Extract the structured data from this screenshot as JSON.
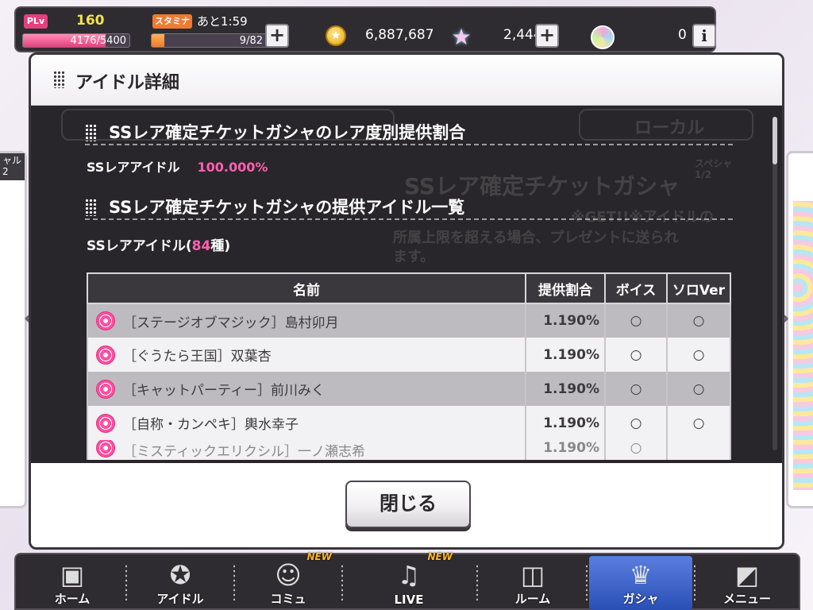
{
  "status": {
    "pl_label": "PLv",
    "pl_level": "160",
    "exp_text": "4176/5400",
    "exp_fraction": 0.773,
    "stamina_label": "スタミナ",
    "stamina_timer": "あと1:59",
    "stamina_text": "9/82",
    "stamina_fraction": 0.11,
    "money": "6,887,687",
    "jewels": "2,444",
    "orbs": "0"
  },
  "background": {
    "left_card_tag": "ャル\n2",
    "ghost_tab_right": "ローカル",
    "ghost_title": "SSレア確定チケットガシャ",
    "ghost_special": "スペシャ\n1/2",
    "ghost_text_1": "※GET!!※アイドルの",
    "ghost_text_2": "所属上限を超える場合、プレゼントに送られ",
    "ghost_text_3": "ます。"
  },
  "modal": {
    "title": "アイドル詳細",
    "section1_title": "SSレア確定チケットガシャのレア度別提供割合",
    "rate_label": "SSレアアイドル",
    "rate_value": "100.000%",
    "section2_title": "SSレア確定チケットガシャの提供アイドル一覧",
    "count_prefix": "SSレアアイドル(",
    "count_value": "84",
    "count_suffix": "種)",
    "table": {
      "headers": [
        "名前",
        "提供割合",
        "ボイス",
        "ソロVer"
      ],
      "rows": [
        {
          "name": "［ステージオブマジック］島村卯月",
          "rate": "1.190%",
          "voice": "○",
          "solo": "○"
        },
        {
          "name": "［ぐうたら王国］双葉杏",
          "rate": "1.190%",
          "voice": "○",
          "solo": "○"
        },
        {
          "name": "［キャットパーティー］前川みく",
          "rate": "1.190%",
          "voice": "○",
          "solo": "○"
        },
        {
          "name": "［自称・カンペキ］輿水幸子",
          "rate": "1.190%",
          "voice": "○",
          "solo": "○"
        },
        {
          "name": "［ミスティックエリクシル］一ノ瀬志希",
          "rate": "1.190%",
          "voice": "○",
          "solo": ""
        }
      ]
    },
    "close_label": "閉じる"
  },
  "nav": {
    "items": [
      {
        "label": "ホーム",
        "icon": "speaker-icon"
      },
      {
        "label": "アイドル",
        "icon": "star-badge-icon"
      },
      {
        "label": "コミュ",
        "icon": "chat-icon",
        "badge": "NEW"
      },
      {
        "label": "LIVE",
        "icon": "music-note-icon",
        "badge": "NEW"
      },
      {
        "label": "ルーム",
        "icon": "room-icon"
      },
      {
        "label": "ガシャ",
        "icon": "crown-icon",
        "active": true
      },
      {
        "label": "メニュー",
        "icon": "menu-icon"
      }
    ]
  }
}
